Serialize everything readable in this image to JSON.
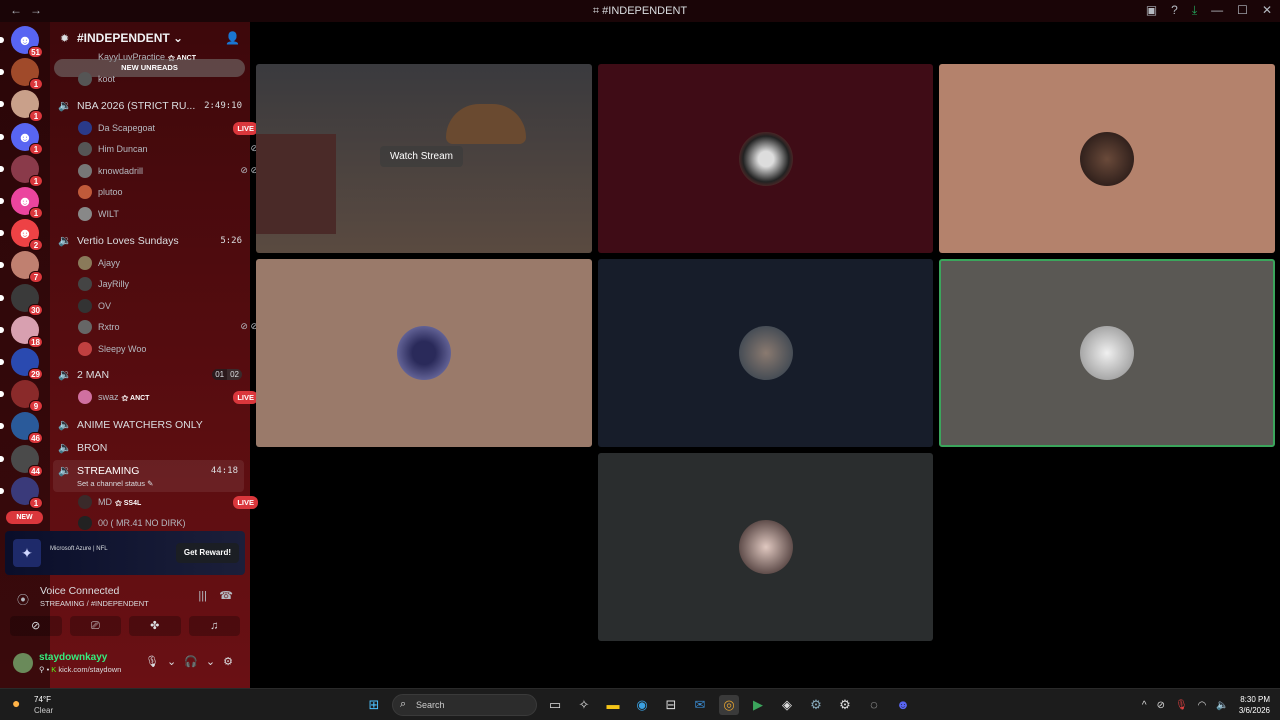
{
  "window": {
    "title": "#INDEPENDENT",
    "nav_back": "←",
    "nav_fwd": "→",
    "controls": [
      "▣",
      "?",
      "⤓",
      "—",
      "☐",
      "✕"
    ]
  },
  "servers": [
    {
      "name": "home",
      "badge": "51",
      "color": "#5865f2",
      "glyph": "☻"
    },
    {
      "name": "server-1",
      "badge": "1",
      "color": "#a04a2a",
      "glyph": ""
    },
    {
      "name": "server-2",
      "badge": "1",
      "color": "#c9a08a",
      "glyph": ""
    },
    {
      "name": "server-3",
      "badge": "1",
      "color": "#5865f2",
      "glyph": "☻"
    },
    {
      "name": "server-4",
      "badge": "1",
      "color": "#8a3a4a",
      "glyph": ""
    },
    {
      "name": "server-5",
      "badge": "1",
      "color": "#eb459e",
      "glyph": "☻"
    },
    {
      "name": "server-6",
      "badge": "2",
      "color": "#ed4245",
      "glyph": "☻"
    },
    {
      "name": "server-7",
      "badge": "7",
      "color": "#c08070",
      "glyph": ""
    },
    {
      "name": "server-8",
      "badge": "30",
      "color": "#3a3a3a",
      "glyph": ""
    },
    {
      "name": "server-9",
      "badge": "18",
      "color": "#d8a0b0",
      "glyph": ""
    },
    {
      "name": "server-10",
      "badge": "29",
      "color": "#2a4ab0",
      "glyph": ""
    },
    {
      "name": "server-11",
      "badge": "9",
      "color": "#8a2a2a",
      "glyph": ""
    },
    {
      "name": "server-12",
      "badge": "46",
      "color": "#2a5a9a",
      "glyph": ""
    },
    {
      "name": "server-13",
      "badge": "44",
      "color": "#4a4a4a",
      "glyph": ""
    },
    {
      "name": "server-14",
      "badge": "1",
      "color": "#3a3a7a",
      "glyph": ""
    }
  ],
  "new_label": "NEW",
  "guild": {
    "name": "#INDEPENDENT",
    "chevron": "⌄"
  },
  "new_unreads": "NEW UNREADS",
  "partial_user": "KayyLuvPractice",
  "partial_tag": "ANCT",
  "top_user": "koot",
  "channels": {
    "nba": {
      "name": "NBA 2026 (STRICT RU...",
      "time": "2:49:10"
    },
    "nba_users": [
      {
        "name": "Da Scapegoat",
        "live": "LIVE",
        "color": "#2a3a8a"
      },
      {
        "name": "Him Duncan",
        "icon": "⊘",
        "color": "#555"
      },
      {
        "name": "knowdadrill",
        "icon": "⊘ ⊘",
        "color": "#777"
      },
      {
        "name": "plutoo",
        "color": "#c05a3a"
      },
      {
        "name": "WILT",
        "color": "#888"
      }
    ],
    "vertio": {
      "name": "Vertio Loves Sundays",
      "time": "5:26"
    },
    "vertio_users": [
      {
        "name": "Ajayy",
        "color": "#8a7a5a"
      },
      {
        "name": "JayRilly",
        "color": "#444"
      },
      {
        "name": "OV",
        "color": "#333"
      },
      {
        "name": "Rxtro",
        "icon": "⊘ ⊘",
        "color": "#666"
      },
      {
        "name": "Sleepy Woo",
        "color": "#c04040"
      }
    ],
    "twoman": {
      "name": "2 MAN",
      "c1": "01",
      "c2": "02"
    },
    "twoman_users": [
      {
        "name": "swaz",
        "tag": "ANCT",
        "live": "LIVE",
        "color": "#d070a0"
      }
    ],
    "anime": {
      "name": "ANIME WATCHERS ONLY"
    },
    "bron": {
      "name": "BRON"
    },
    "streaming": {
      "name": "STREAMING",
      "time": "44:18",
      "status": "Set a channel status"
    },
    "streaming_users": [
      {
        "name": "MD",
        "tag": "SS4L",
        "live": "LIVE",
        "color": "#3a2a2a"
      },
      {
        "name": "00 ( MR.41 NO DIRK)",
        "color": "#222"
      }
    ]
  },
  "promo": {
    "sponsors": "Microsoft Azure  |  NFL",
    "button": "Get Reward!"
  },
  "voice": {
    "title": "Voice Connected",
    "sub": "STREAMING / #INDEPENDENT"
  },
  "user": {
    "name": "staydownkayy",
    "status": "kick.com/staydown"
  },
  "tiles": {
    "watch_stream": "Watch Stream"
  },
  "taskbar": {
    "temp": "74°F",
    "cond": "Clear",
    "search": "Search",
    "time": "8:30 PM",
    "date": "3/6/2026"
  }
}
